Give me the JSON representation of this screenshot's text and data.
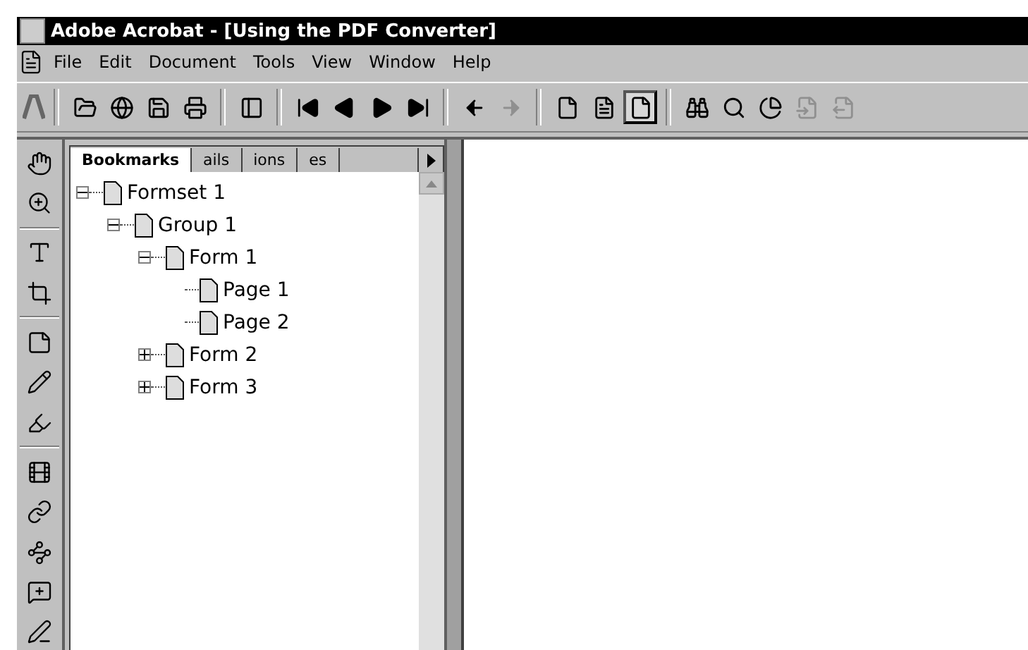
{
  "window": {
    "title": "Adobe Acrobat - [Using the PDF Converter]"
  },
  "menu": [
    "File",
    "Edit",
    "Document",
    "Tools",
    "View",
    "Window",
    "Help"
  ],
  "toolbar": [
    {
      "disabled": false,
      "selected": false
    },
    {
      "disabled": false,
      "selected": false
    },
    {
      "disabled": false,
      "selected": false
    },
    {
      "disabled": false,
      "selected": false
    },
    {
      "disabled": false,
      "selected": false
    },
    {
      "disabled": false,
      "selected": false
    },
    {
      "disabled": false,
      "selected": false
    },
    {
      "disabled": false,
      "selected": false
    },
    {
      "disabled": false,
      "selected": false
    },
    {
      "disabled": false,
      "selected": false
    },
    {
      "disabled": true,
      "selected": false
    },
    {
      "disabled": false,
      "selected": false
    },
    {
      "disabled": false,
      "selected": false
    },
    {
      "disabled": false,
      "selected": true
    },
    {
      "disabled": false,
      "selected": false
    },
    {
      "disabled": false,
      "selected": false
    },
    {
      "disabled": false,
      "selected": false
    },
    {
      "disabled": true,
      "selected": false
    },
    {
      "disabled": true,
      "selected": false
    }
  ],
  "tabs": [
    {
      "label": "Bookmarks",
      "selected": true
    },
    {
      "label": "ails",
      "selected": false
    },
    {
      "label": "ions",
      "selected": false
    },
    {
      "label": "es",
      "selected": false
    }
  ],
  "bookmarks": [
    {
      "label": "Formset 1",
      "expanded": true,
      "children": [
        {
          "label": "Group 1",
          "expanded": true,
          "children": [
            {
              "label": "Form 1",
              "expanded": true,
              "children": [
                {
                  "label": "Page 1"
                },
                {
                  "label": "Page 2"
                }
              ]
            },
            {
              "label": "Form 2",
              "expanded": false
            },
            {
              "label": "Form 3",
              "expanded": false
            }
          ]
        }
      ]
    }
  ]
}
